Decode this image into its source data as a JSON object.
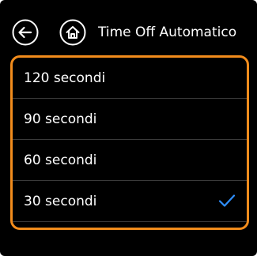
{
  "header": {
    "title": "Time Off Automatico",
    "back_icon": "back-arrow-icon",
    "home_icon": "home-icon"
  },
  "options": [
    {
      "label": "120 secondi",
      "selected": false
    },
    {
      "label": "90 secondi",
      "selected": false
    },
    {
      "label": "60 secondi",
      "selected": false
    },
    {
      "label": "30 secondi",
      "selected": true
    }
  ],
  "colors": {
    "background": "#000000",
    "accent_border": "#f28c1c",
    "checkmark": "#2f8fff",
    "text": "#ffffff"
  }
}
